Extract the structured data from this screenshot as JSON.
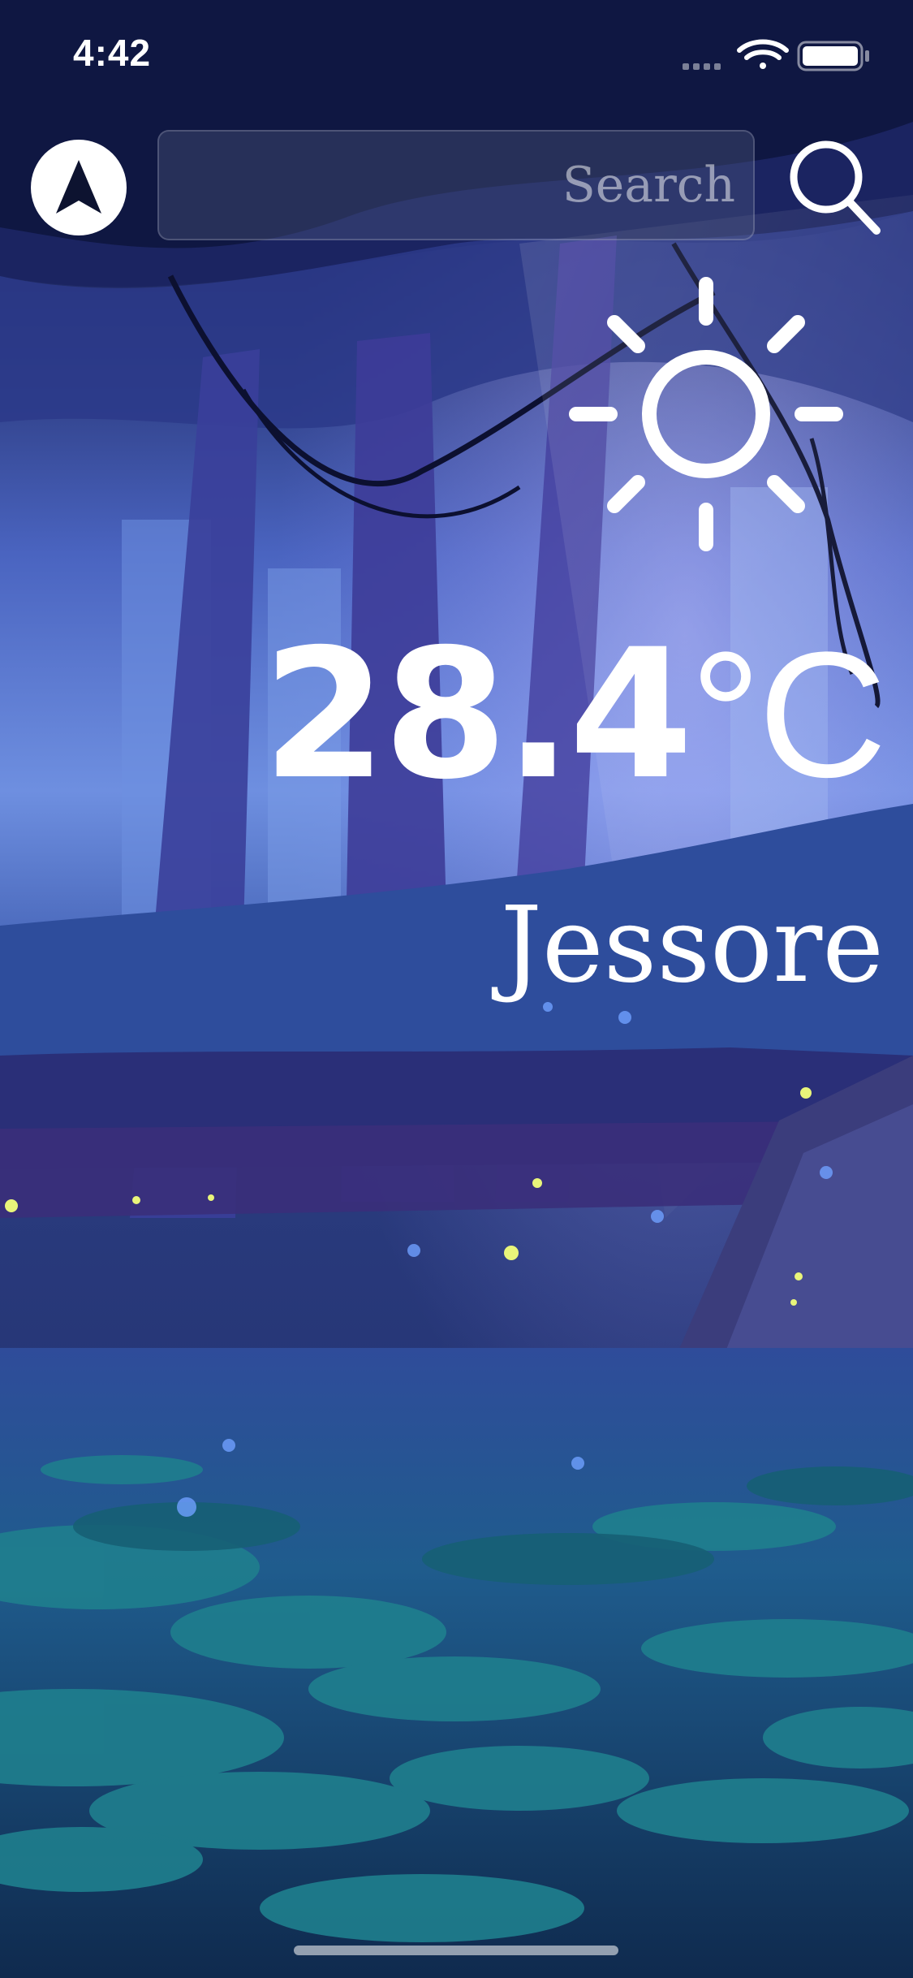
{
  "status_bar": {
    "time": "4:42",
    "icons": [
      "cellular-signal-icon",
      "wifi-icon",
      "battery-icon"
    ]
  },
  "header": {
    "location_icon": "navigation-arrow-icon",
    "search": {
      "value": "",
      "placeholder": "Search"
    },
    "search_icon": "search-icon"
  },
  "weather": {
    "condition_icon": "sun-icon",
    "temperature_value": "28.4",
    "temperature_unit": "°C",
    "city": "Jessore"
  },
  "colors": {
    "text": "#ffffff",
    "sky_top": "#0b1030",
    "sky_mid": "#5a7fd8",
    "water": "#1d5a86"
  }
}
